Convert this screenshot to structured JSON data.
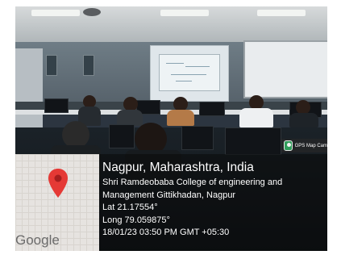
{
  "badge": {
    "label": "GPS Map Cam",
    "icon": "gps-map-camera-icon"
  },
  "map": {
    "brand": "Google",
    "pin_icon": "location-pin-icon",
    "pin_color": "#e53935"
  },
  "location": {
    "title": "Nagpur, Maharashtra, India",
    "address_line_1": "Shri Ramdeobaba College of engineering and",
    "address_line_2": "Management Gittikhadan, Nagpur",
    "latitude": "Lat 21.17554°",
    "longitude": "Long 79.059875°",
    "timestamp": "18/01/23 03:50 PM GMT +05:30"
  },
  "colors": {
    "overlay": "rgba(10,10,10,0.55)",
    "text": "#ffffff"
  }
}
